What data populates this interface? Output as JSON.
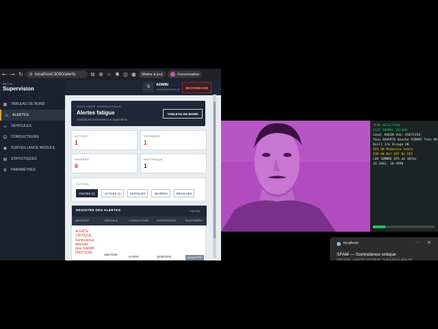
{
  "browser": {
    "url": "localhost:3000/alerts",
    "update_label": "Mettre à jour",
    "conversation_label": "Conversation"
  },
  "sidebar": {
    "brand_small": "SFAM",
    "brand_title": "Supervision",
    "items": [
      {
        "label": "TABLEAU DE BORD",
        "icon": "dashboard-icon",
        "active": false
      },
      {
        "label": "ALERTES",
        "icon": "warning-icon",
        "active": true
      },
      {
        "label": "VÉHICULES",
        "icon": "truck-icon",
        "active": false
      },
      {
        "label": "CONDUCTEURS",
        "icon": "user-icon",
        "active": false
      },
      {
        "label": "SURVEILLANCE MODULE",
        "icon": "camera-icon",
        "active": false
      },
      {
        "label": "STATISTIQUES",
        "icon": "chart-icon",
        "active": false
      },
      {
        "label": "PARAMÈTRES",
        "icon": "gear-icon",
        "active": false
      }
    ]
  },
  "topbar": {
    "avatar_letter": "S",
    "admin_name": "ADMIN",
    "admin_role": "ADMINISTRATEUR",
    "logout_label": "DÉCONNEXION"
  },
  "hero": {
    "kicker": "VIGILANCE CONDUCTEUR",
    "title": "Alertes fatigue",
    "subtitle": "Journal des événements et traitements",
    "button_label": "TABLEAU DE BORD"
  },
  "stats": [
    {
      "label": "ACTIVES",
      "value": "1",
      "color": "#c0392b"
    },
    {
      "label": "CRITIQUES",
      "value": "1",
      "color": "#c0392b"
    },
    {
      "label": "SÉVÈRES",
      "value": "0",
      "color": "#c0392b"
    },
    {
      "label": "HISTORIQUE",
      "value": "1",
      "color": "#1f2838"
    }
  ],
  "filters": {
    "label": "FILTRES",
    "buttons": [
      "TOUTES (1)",
      "ACTIVES (1)",
      "CRITIQUES",
      "SÉVÈRES",
      "RÉSOLUES"
    ]
  },
  "register": {
    "title": "REGISTRE DES ALERTES",
    "count": "1 ligne(s)",
    "columns": [
      "MESSAGE",
      "VÉHICULE",
      "CONDUCTEUR",
      "HORODATAGE",
      "TRAITEMENT"
    ],
    "row": {
      "message_lines": [
        "ALERTE",
        "CRITIQUE :",
        "Somnolence",
        "détectée",
        "pour KARIM",
        "(45671156)"
      ],
      "vehicle": "45671156",
      "driver": "KARIM",
      "timestamp": "28/06/2026",
      "action": "ACQUITTER"
    }
  },
  "detection": {
    "lines": [
      {
        "text": "SFAM DETECTION",
        "color": "#22c55e"
      },
      {
        "text": "ETAT NORMAL   20/100",
        "color": "#22c55e"
      },
      {
        "text": "Cond: KARIM   Veh: 45671156",
        "color": "#e6e6e6"
      },
      {
        "text": "Yeux OUVERTS  Bouche FERMEE  Tete OK",
        "color": "#e6e6e6"
      },
      {
        "text": "Baill 2/m  Visage OK",
        "color": "#e6e6e6"
      },
      {
        "text": "GPS OK Medenine 1km/h",
        "color": "#facc15"
      },
      {
        "text": "SIM OK  Rel OFF   Bz OFF",
        "color": "#facc15"
      },
      {
        "text": "LDR SOMBRE   API ok   30fps",
        "color": "#e6e6e6"
      },
      {
        "text": "33.3462, 10.4990",
        "color": "#e6e6e6"
      }
    ],
    "progress": 0.2,
    "progress_color": "#22c55e"
  },
  "notification": {
    "source": "localhost",
    "title": "SFAM — Somnolence critique",
    "body": "45671156 · ALERTE CRITIQUE : Somnolence détectée"
  }
}
